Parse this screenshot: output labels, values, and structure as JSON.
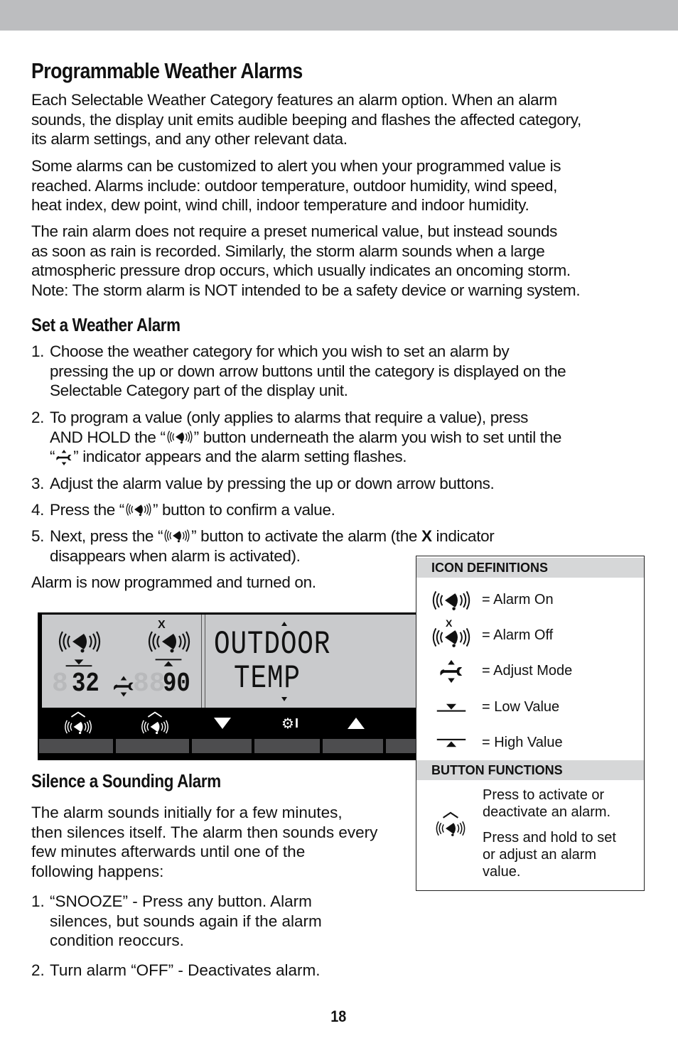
{
  "page": {
    "title": "Programmable Weather Alarms",
    "intro_paragraphs": [
      "Each Selectable Weather Category features an alarm option. When an alarm sounds, the display unit emits audible beeping and flashes the affected category, its alarm settings, and any other relevant data.",
      "Some alarms can be customized to alert you when your programmed value is reached. Alarms include: outdoor temperature, outdoor humidity, wind speed, heat index, dew point, wind chill, indoor temperature and indoor humidity.",
      "The rain alarm does not require a preset numerical value, but instead sounds as soon as rain is recorded. Similarly, the storm alarm sounds when a large atmospheric pressure drop occurs, which usually indicates an oncoming storm. Note: The storm alarm is NOT intended to be a safety device or warning system."
    ],
    "intro_lines": [
      [
        "Each Selectable Weather Category features an alarm option. When an alarm",
        "sounds, the display unit emits audible beeping and flashes the affected category,",
        "its alarm settings, and any other relevant data."
      ],
      [
        "Some alarms can be customized to alert you when your programmed value is",
        "reached. Alarms include: outdoor temperature, outdoor humidity, wind speed,",
        "heat index, dew point, wind chill, indoor temperature and indoor humidity."
      ],
      [
        "The rain alarm does not require a preset numerical value, but instead sounds",
        "as soon as rain is recorded. Similarly, the storm alarm sounds when a large",
        "atmospheric pressure drop occurs, which usually indicates an oncoming storm.",
        "Note: The storm alarm is NOT intended to be a safety device or warning system."
      ]
    ],
    "page_number": "18"
  },
  "set_alarm": {
    "heading": "Set a Weather Alarm",
    "steps": [
      {
        "num": "1.",
        "lines": [
          "Choose the weather category for which you wish to set an alarm by",
          "pressing the up or down arrow buttons until the category is displayed on the",
          "Selectable Category part of the display unit."
        ]
      },
      {
        "num": "2.",
        "line1": "To program a value (only applies to alarms that require a value), press",
        "line2a": "AND HOLD the “",
        "line2b": "” button underneath the alarm you wish to set until the",
        "line3a": "“",
        "line3b": "” indicator appears and the alarm setting flashes."
      },
      {
        "num": "3.",
        "text": "Adjust the alarm value by pressing the up or down arrow buttons."
      },
      {
        "num": "4.",
        "a": "Press the “",
        "b": "” button to confirm a value."
      },
      {
        "num": "5.",
        "a": "Next, press the “",
        "b": "” button to activate the alarm (the ",
        "x": "X",
        "c": " indicator",
        "line2": "disappears when alarm is activated)."
      }
    ],
    "conclusion": "Alarm is now programmed and turned on."
  },
  "display": {
    "low_value": "32",
    "high_value": "90",
    "low_ghost": "8.",
    "high_ghost": "88.",
    "category_line1": "OUTDOOR",
    "category_line2": "TEMP",
    "alarm_off_marker": "X",
    "buttons": [
      {
        "name": "alarm-low-button",
        "icon": "alarm-bell-icon"
      },
      {
        "name": "alarm-high-button",
        "icon": "alarm-bell-icon"
      },
      {
        "name": "down-arrow-button",
        "icon": "down-arrow-icon"
      },
      {
        "name": "settings-button",
        "icon": "gear-wrench-icon"
      },
      {
        "name": "up-arrow-button",
        "icon": "up-arrow-icon"
      }
    ]
  },
  "silence": {
    "heading": "Silence a Sounding Alarm",
    "paragraph_lines": [
      "The alarm sounds initially for a few minutes,",
      "then silences itself. The alarm then sounds every",
      "few minutes afterwards until one of the",
      "following happens:"
    ],
    "items": [
      {
        "num": "1.",
        "lines": [
          "“SNOOZE” - Press any button. Alarm",
          "silences, but sounds again if the alarm",
          "condition reoccurs."
        ]
      },
      {
        "num": "2.",
        "lines": [
          "Turn alarm “OFF” - Deactivates alarm."
        ]
      }
    ]
  },
  "panel": {
    "icon_definitions_title": "ICON DEFINITIONS",
    "definitions": [
      {
        "icon": "alarm-on-icon",
        "label": "= Alarm On"
      },
      {
        "icon": "alarm-off-icon",
        "label": "= Alarm Off"
      },
      {
        "icon": "adjust-mode-icon",
        "label": "= Adjust Mode"
      },
      {
        "icon": "low-value-icon",
        "label": "= Low Value"
      },
      {
        "icon": "high-value-icon",
        "label": "= High Value"
      }
    ],
    "button_functions_title": "BUTTON FUNCTIONS",
    "button_function_texts": [
      [
        "Press to activate or",
        "deactivate an alarm."
      ],
      [
        "Press and hold to set",
        "or adjust an alarm",
        "value."
      ]
    ]
  }
}
